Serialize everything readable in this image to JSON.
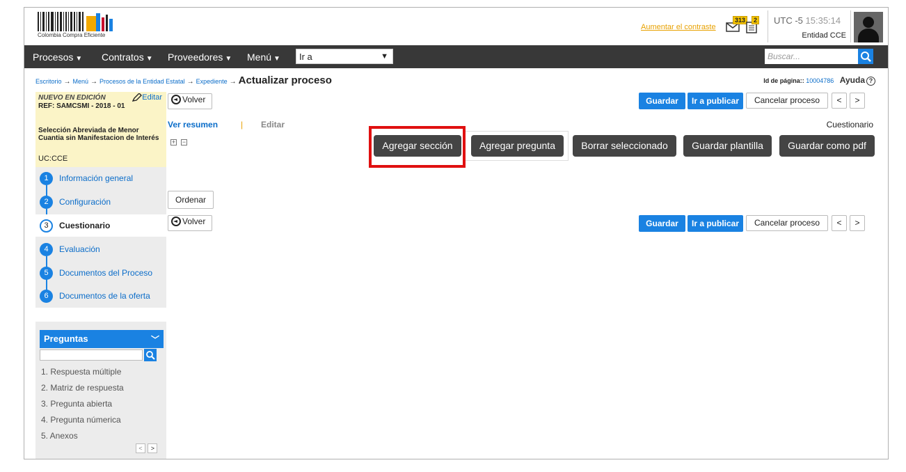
{
  "header": {
    "logo_text": "Colombia Compra Eficiente",
    "contrast_link": "Aumentar el contraste",
    "mail_count": "313",
    "notes_count": "2",
    "utc_label": "UTC -5",
    "time": "15:35:14",
    "entity": "Entidad CCE"
  },
  "nav": {
    "items": [
      "Procesos",
      "Contratos",
      "Proveedores",
      "Menú"
    ],
    "goto_value": "Ir a",
    "search_placeholder": "Buscar..."
  },
  "breadcrumb": {
    "items": [
      "Escritorio",
      "Menú",
      "Procesos de la Entidad Estatal",
      "Expediente"
    ],
    "current": "Actualizar proceso",
    "arrow": "→"
  },
  "page_id": {
    "label": "Id de página::",
    "value": "10004786",
    "help": "Ayuda"
  },
  "process": {
    "status": "NUEVO EN EDICIÓN",
    "edit_label": "Editar",
    "ref": "REF: SAMCSMI - 2018 - 01",
    "description": "Selección Abreviada de Menor Cuantia sin Manifestacion de Interés",
    "uc": "UC:CCE"
  },
  "steps": [
    {
      "num": "1",
      "label": "Información general",
      "active": false
    },
    {
      "num": "2",
      "label": "Configuración",
      "active": false
    },
    {
      "num": "3",
      "label": "Cuestionario",
      "active": true
    },
    {
      "num": "4",
      "label": "Evaluación",
      "active": false
    },
    {
      "num": "5",
      "label": "Documentos del Proceso",
      "active": false
    },
    {
      "num": "6",
      "label": "Documentos de la oferta",
      "active": false
    }
  ],
  "questions_panel": {
    "title": "Preguntas",
    "items": [
      "1. Respuesta múltiple",
      "2. Matriz de respuesta",
      "3. Pregunta abierta",
      "4. Pregunta númerica",
      "5. Anexos"
    ],
    "prev": "<",
    "next": ">"
  },
  "actions": {
    "volver": "Volver",
    "guardar": "Guardar",
    "publicar": "Ir a publicar",
    "cancelar": "Cancelar proceso",
    "prev": "<",
    "next": ">",
    "ordenar": "Ordenar"
  },
  "tabs": {
    "summary": "Ver resumen",
    "separator": "|",
    "edit": "Editar",
    "section_label": "Cuestionario"
  },
  "toolbar": {
    "agregar_seccion": "Agregar sección",
    "agregar_pregunta": "Agregar pregunta",
    "borrar": "Borrar seleccionado",
    "guardar_plantilla": "Guardar plantilla",
    "guardar_pdf": "Guardar como pdf"
  },
  "colors": {
    "accent_blue": "#1a82e2",
    "nav_bg": "#383838",
    "highlight_red": "#e01010",
    "dark_button": "#444444"
  }
}
